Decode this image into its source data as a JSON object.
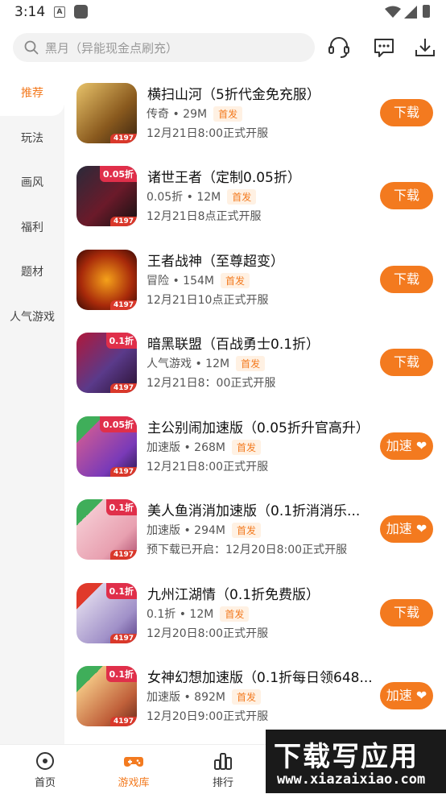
{
  "status": {
    "time": "3:14",
    "a_icon": "A"
  },
  "search": {
    "placeholder": "黑月（异能现金点刷充）"
  },
  "sidebar": {
    "items": [
      {
        "label": "推荐"
      },
      {
        "label": "玩法"
      },
      {
        "label": "画风"
      },
      {
        "label": "福利"
      },
      {
        "label": "题材"
      },
      {
        "label": "人气游戏"
      }
    ]
  },
  "games": [
    {
      "title": "横扫山河（5折代金免充服）",
      "meta": "传奇 • 29M",
      "tag": "首发",
      "date": "12月21日8:00正式开服",
      "button": "下载",
      "badge": "4197",
      "corner": ""
    },
    {
      "title": "诸世王者（定制0.05折）",
      "meta": "0.05折 • 12M",
      "tag": "首发",
      "date": "12月21日8点正式开服",
      "button": "下载",
      "badge": "4197",
      "corner": "0.05折"
    },
    {
      "title": "王者战神（至尊超变）",
      "meta": "冒险 • 154M",
      "tag": "首发",
      "date": "12月21日10点正式开服",
      "button": "下载",
      "badge": "4197",
      "corner": ""
    },
    {
      "title": "暗黑联盟（百战勇士0.1折）",
      "meta": "人气游戏 • 12M",
      "tag": "首发",
      "date": "12月21日8：00正式开服",
      "button": "下载",
      "badge": "4197",
      "corner": "0.1折"
    },
    {
      "title": "主公别闹加速版（0.05折升官高升）",
      "meta": "加速版 • 268M",
      "tag": "首发",
      "date": "12月21日8:00正式开服",
      "button": "加速 ❤",
      "badge": "4197",
      "corner": "0.05折"
    },
    {
      "title": "美人鱼消消加速版（0.1折消消乐...",
      "meta": "加速版 • 294M",
      "tag": "首发",
      "date": "预下载已开启：12月20日8:00正式开服",
      "button": "加速 ❤",
      "badge": "4197",
      "corner": "0.1折"
    },
    {
      "title": "九州江湖情（0.1折免费版）",
      "meta": "0.1折 • 12M",
      "tag": "首发",
      "date": "12月20日8:00正式开服",
      "button": "下载",
      "badge": "4197",
      "corner": "0.1折"
    },
    {
      "title": "女神幻想加速版（0.1折每日领648...",
      "meta": "加速版 • 892M",
      "tag": "首发",
      "date": "12月20日9:00正式开服",
      "button": "加速 ❤",
      "badge": "4197",
      "corner": "0.1折"
    }
  ],
  "nav": {
    "home": "首页",
    "library": "游戏库",
    "rank": "排行"
  },
  "watermark": {
    "title": "下载写应用",
    "url": "www.xiazaixiao.com"
  },
  "colors": {
    "accent": "#f37a1f",
    "tag_bg": "#fff1e3",
    "sidebar_bg": "#f5f5f5"
  }
}
